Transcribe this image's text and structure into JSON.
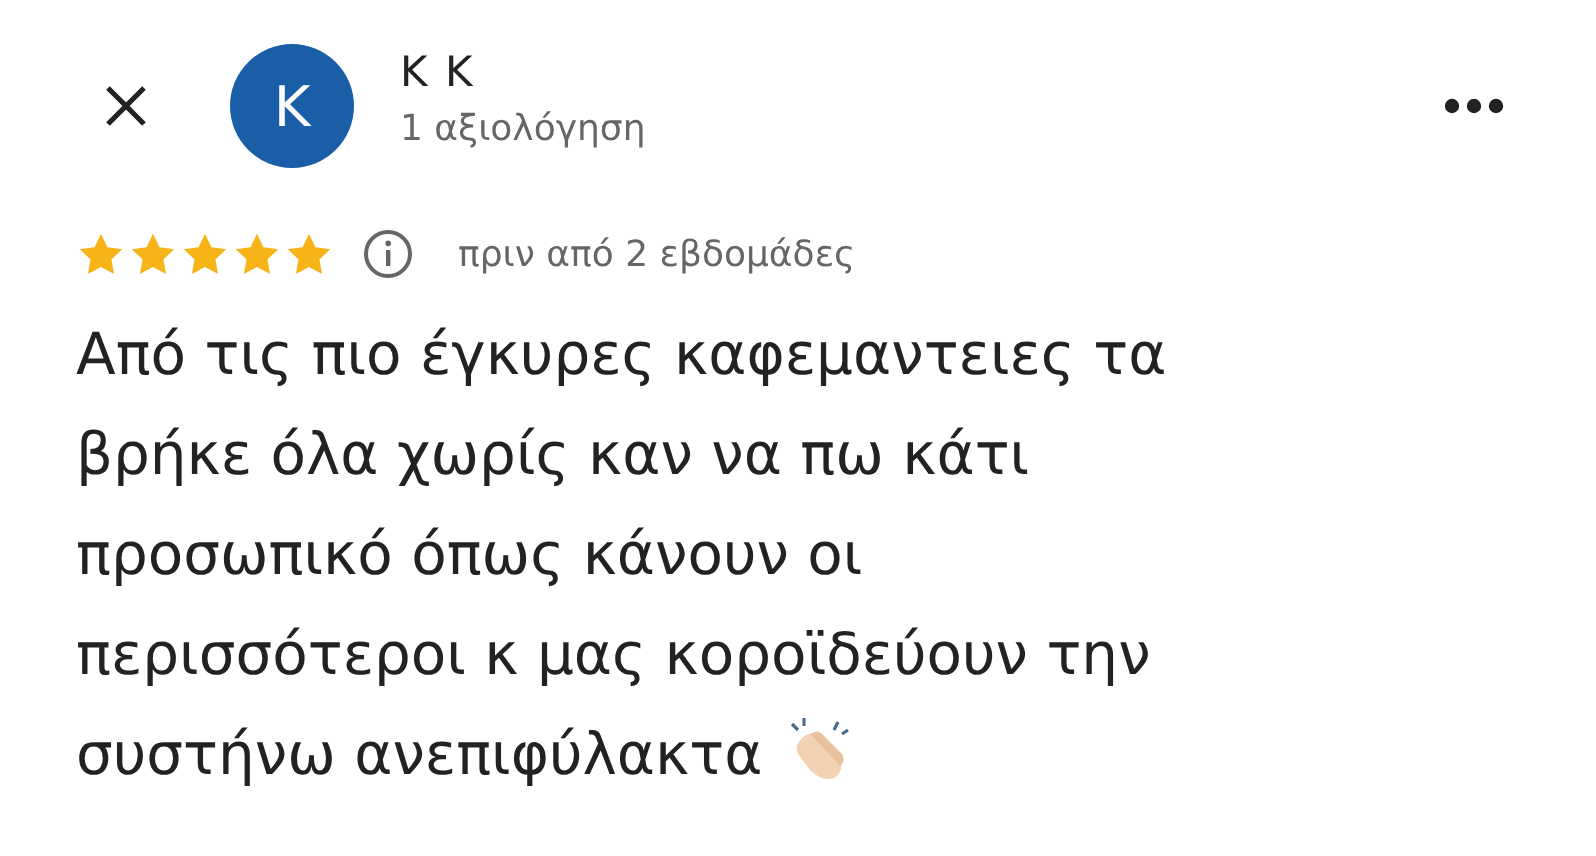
{
  "reviewer": {
    "initial": "K",
    "name": "K K",
    "review_count": "1 αξιολόγηση"
  },
  "review": {
    "stars": 5,
    "date": "πριν από 2 εβδομάδες",
    "text": "Από τις πιο έγκυρες καφεμαντειες τα\nβρήκε όλα χωρίς καν να πω κάτι\nπροσωπικό όπως κάνουν οι\nπερισσότεροι κ μας κοροϊδεύουν την\nσυστήνω ανεπιφύλακτα"
  }
}
